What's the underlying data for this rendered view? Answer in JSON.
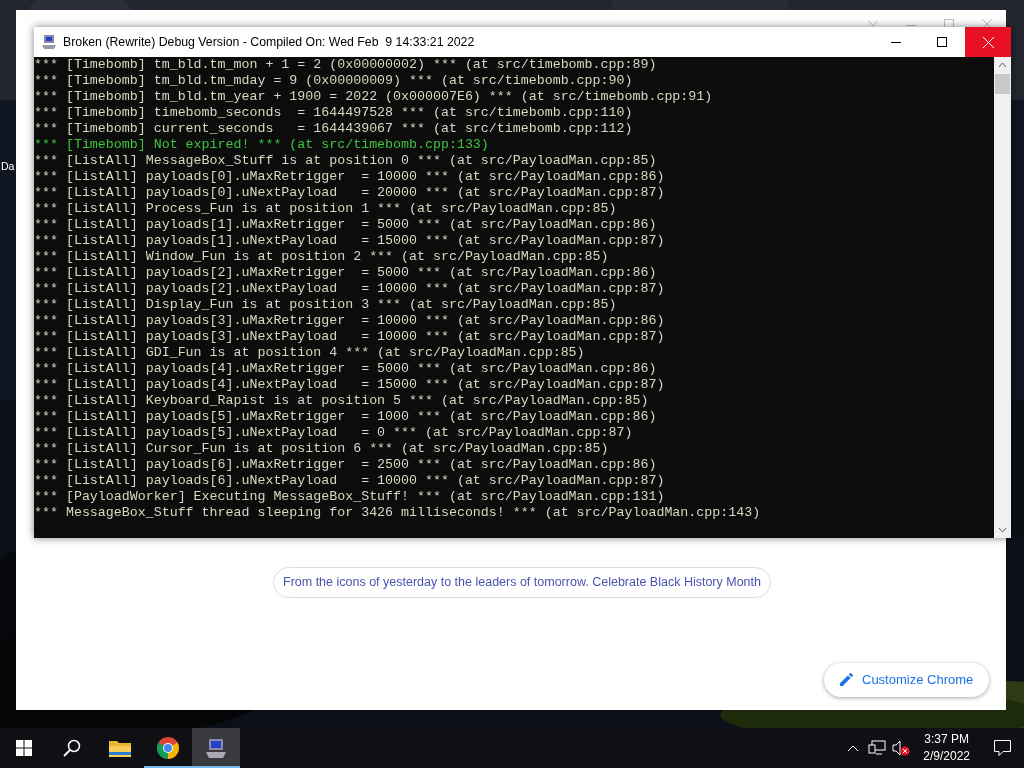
{
  "desktop": {
    "icon_labels": [
      "Da"
    ]
  },
  "browser_window": {
    "banner": "From the icons of yesterday to the leaders of tomorrow. Celebrate Black History Month",
    "customize_button": "Customize Chrome"
  },
  "console_window": {
    "title": "Broken (Rewrite) Debug Version - Compiled On: Wed Feb  9 14:33:21 2022",
    "lines": [
      {
        "kind": "info",
        "text": "*** [Timebomb] tm_bld.tm_mon + 1 = 2 (0x00000002) *** (at src/timebomb.cpp:89)"
      },
      {
        "kind": "info",
        "text": "*** [Timebomb] tm_bld.tm_mday = 9 (0x00000009) *** (at src/timebomb.cpp:90)"
      },
      {
        "kind": "info",
        "text": "*** [Timebomb] tm_bld.tm_year + 1900 = 2022 (0x000007E6) *** (at src/timebomb.cpp:91)"
      },
      {
        "kind": "info",
        "text": "*** [Timebomb] timebomb_seconds  = 1644497528 *** (at src/timebomb.cpp:110)"
      },
      {
        "kind": "info",
        "text": "*** [Timebomb] current_seconds   = 1644439067 *** (at src/timebomb.cpp:112)"
      },
      {
        "kind": "success",
        "text": "*** [Timebomb] Not expired! *** (at src/timebomb.cpp:133)"
      },
      {
        "kind": "info",
        "text": "*** [ListAll] MessageBox_Stuff is at position 0 *** (at src/PayloadMan.cpp:85)"
      },
      {
        "kind": "info",
        "text": "*** [ListAll] payloads[0].uMaxRetrigger  = 10000 *** (at src/PayloadMan.cpp:86)"
      },
      {
        "kind": "info",
        "text": "*** [ListAll] payloads[0].uNextPayload   = 20000 *** (at src/PayloadMan.cpp:87)"
      },
      {
        "kind": "info",
        "text": "*** [ListAll] Process_Fun is at position 1 *** (at src/PayloadMan.cpp:85)"
      },
      {
        "kind": "info",
        "text": "*** [ListAll] payloads[1].uMaxRetrigger  = 5000 *** (at src/PayloadMan.cpp:86)"
      },
      {
        "kind": "info",
        "text": "*** [ListAll] payloads[1].uNextPayload   = 15000 *** (at src/PayloadMan.cpp:87)"
      },
      {
        "kind": "info",
        "text": "*** [ListAll] Window_Fun is at position 2 *** (at src/PayloadMan.cpp:85)"
      },
      {
        "kind": "info",
        "text": "*** [ListAll] payloads[2].uMaxRetrigger  = 5000 *** (at src/PayloadMan.cpp:86)"
      },
      {
        "kind": "info",
        "text": "*** [ListAll] payloads[2].uNextPayload   = 10000 *** (at src/PayloadMan.cpp:87)"
      },
      {
        "kind": "info",
        "text": "*** [ListAll] Display_Fun is at position 3 *** (at src/PayloadMan.cpp:85)"
      },
      {
        "kind": "info",
        "text": "*** [ListAll] payloads[3].uMaxRetrigger  = 10000 *** (at src/PayloadMan.cpp:86)"
      },
      {
        "kind": "info",
        "text": "*** [ListAll] payloads[3].uNextPayload   = 10000 *** (at src/PayloadMan.cpp:87)"
      },
      {
        "kind": "info",
        "text": "*** [ListAll] GDI_Fun is at position 4 *** (at src/PayloadMan.cpp:85)"
      },
      {
        "kind": "info",
        "text": "*** [ListAll] payloads[4].uMaxRetrigger  = 5000 *** (at src/PayloadMan.cpp:86)"
      },
      {
        "kind": "info",
        "text": "*** [ListAll] payloads[4].uNextPayload   = 15000 *** (at src/PayloadMan.cpp:87)"
      },
      {
        "kind": "info",
        "text": "*** [ListAll] Keyboard_Rapist is at position 5 *** (at src/PayloadMan.cpp:85)"
      },
      {
        "kind": "info",
        "text": "*** [ListAll] payloads[5].uMaxRetrigger  = 1000 *** (at src/PayloadMan.cpp:86)"
      },
      {
        "kind": "info",
        "text": "*** [ListAll] payloads[5].uNextPayload   = 0 *** (at src/PayloadMan.cpp:87)"
      },
      {
        "kind": "info",
        "text": "*** [ListAll] Cursor_Fun is at position 6 *** (at src/PayloadMan.cpp:85)"
      },
      {
        "kind": "info",
        "text": "*** [ListAll] payloads[6].uMaxRetrigger  = 2500 *** (at src/PayloadMan.cpp:86)"
      },
      {
        "kind": "info",
        "text": "*** [ListAll] payloads[6].uNextPayload   = 10000 *** (at src/PayloadMan.cpp:87)"
      },
      {
        "kind": "info",
        "text": "*** [PayloadWorker] Executing MessageBox_Stuff! *** (at src/PayloadMan.cpp:131)"
      },
      {
        "kind": "info",
        "text": "*** MessageBox_Stuff thread sleeping for 3426 milliseconds! *** (at src/PayloadMan.cpp:143)"
      }
    ]
  },
  "taskbar": {
    "apps": [
      {
        "kind": "explorer",
        "running": false,
        "selected": false
      },
      {
        "kind": "chrome",
        "running": true,
        "selected": false
      },
      {
        "kind": "debug-app",
        "running": true,
        "selected": true
      }
    ],
    "volume_muted": true,
    "clock": {
      "time": "3:37 PM",
      "date": "2/9/2022"
    }
  }
}
